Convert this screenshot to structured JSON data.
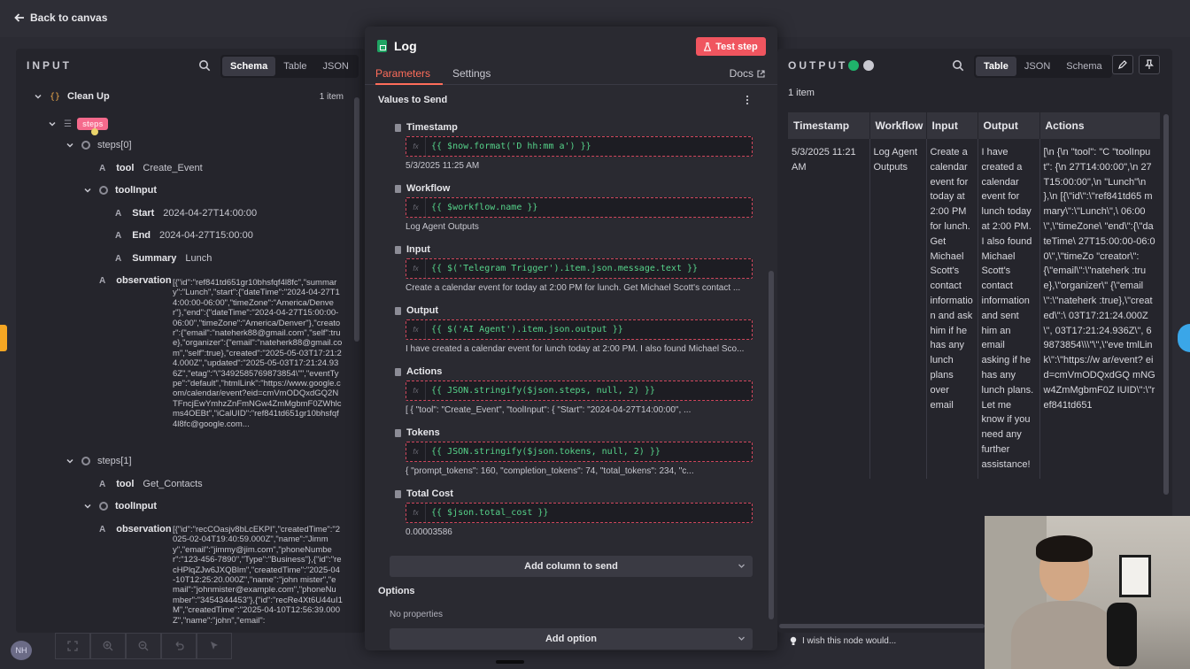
{
  "topbar": {
    "back_label": "Back to canvas"
  },
  "input": {
    "title": "INPUT",
    "views": [
      "Schema",
      "Table",
      "JSON"
    ],
    "active_view": "Schema",
    "root": {
      "name": "Clean Up",
      "count": "1 item"
    },
    "steps_key": "steps",
    "step0": {
      "name": "steps[0]",
      "tool_key": "tool",
      "tool_val": "Create_Event",
      "toolinput_key": "toolInput",
      "start_key": "Start",
      "start_val": "2024-04-27T14:00:00",
      "end_key": "End",
      "end_val": "2024-04-27T15:00:00",
      "summary_key": "Summary",
      "summary_val": "Lunch",
      "observation_key": "observation",
      "observation_val": "[{\"id\":\"ref841td651gr10bhsfqf4l8fc\",\"summary\":\"Lunch\",\"start\":{\"dateTime\":\"2024-04-27T14:00:00-06:00\",\"timeZone\":\"America/Denver\"},\"end\":{\"dateTime\":\"2024-04-27T15:00:00-06:00\",\"timeZone\":\"America/Denver\"},\"creator\":{\"email\":\"nateherk88@gmail.com\",\"self\":true},\"organizer\":{\"email\":\"nateherk88@gmail.com\",\"self\":true},\"created\":\"2025-05-03T17:21:24.000Z\",\"updated\":\"2025-05-03T17:21:24.936Z\",\"etag\":\"\\\"3492585769873854\\\"\",\"eventType\":\"default\",\"htmlLink\":\"https://www.google.com/calendar/event?eid=cmVmODQxdGQ2NTFncjEwYmhzZnFmNGw4ZmMgbmF0ZWhlcms4OEBt\",\"iCalUID\":\"ref841td651gr10bhsfqf4l8fc@google.com..."
    },
    "step1": {
      "name": "steps[1]",
      "tool_key": "tool",
      "tool_val": "Get_Contacts",
      "toolinput_key": "toolInput",
      "observation_key": "observation",
      "observation_val": "[{\"id\":\"recCOasjv8bLcEKPI\",\"createdTime\":\"2025-02-04T19:40:59.000Z\",\"name\":\"Jimmy\",\"email\":\"jimmy@jim.com\",\"phoneNumber\":\"123-456-7890\",\"Type\":\"Business\"},{\"id\":\"recHPlqZJw6JXQBlm\",\"createdTime\":\"2025-04-10T12:25:20.000Z\",\"name\":\"john mister\",\"email\":\"johnmister@example.com\",\"phoneNumber\":\"3454344453\"},{\"id\":\"recRe4Xt6U44uI1M\",\"createdTime\":\"2025-04-10T12:56:39.000Z\",\"name\":\"john\",\"email\":"
    }
  },
  "log": {
    "title": "Log",
    "test_step_label": "Test step",
    "tabs": [
      "Parameters",
      "Settings"
    ],
    "active_tab": "Parameters",
    "docs_label": "Docs",
    "values_title": "Values to Send",
    "fields": [
      {
        "label": "Timestamp",
        "expr": "{{ $now.format('D hh:mm a') }}",
        "preview": "5/3/2025 11:25 AM"
      },
      {
        "label": "Workflow",
        "expr": "{{ $workflow.name }}",
        "preview": "Log Agent Outputs"
      },
      {
        "label": "Input",
        "expr": "{{ $('Telegram Trigger').item.json.message.text }}",
        "preview": "Create a calendar event for today at 2:00 PM for lunch. Get Michael Scott's contact ..."
      },
      {
        "label": "Output",
        "expr": "{{ $('AI Agent').item.json.output }}",
        "preview": "I have created a calendar event for lunch today at 2:00 PM. I also found Michael Sco..."
      },
      {
        "label": "Actions",
        "expr": "{{ JSON.stringify($json.steps, null, 2) }}",
        "preview": "[   {     \"tool\": \"Create_Event\",     \"toolInput\": {       \"Start\": \"2024-04-27T14:00:00\",    ..."
      },
      {
        "label": "Tokens",
        "expr": "{{ JSON.stringify($json.tokens, null, 2) }}",
        "preview": "{   \"prompt_tokens\": 160,   \"completion_tokens\": 74,   \"total_tokens\": 234,   \"c..."
      },
      {
        "label": "Total Cost",
        "expr": "{{ $json.total_cost }}",
        "preview": "0.00003586"
      }
    ],
    "add_column_label": "Add column to send",
    "options_title": "Options",
    "no_properties": "No properties",
    "add_option_label": "Add option"
  },
  "output": {
    "title": "OUTPUT",
    "views": [
      "Table",
      "JSON",
      "Schema"
    ],
    "active_view": "Table",
    "count": "1 item",
    "columns": [
      "Timestamp",
      "Workflow",
      "Input",
      "Output",
      "Actions"
    ],
    "row": [
      "5/3/2025 11:21 AM",
      "Log Agent Outputs",
      "Create a calendar event for today at 2:00 PM for lunch. Get Michael Scott's contact information and ask him if he has any lunch plans over email",
      "I have created a calendar event for lunch today at 2:00 PM. I also found Michael Scott's contact information and sent him an email asking if he has any lunch plans. Let me know if you need any further assistance!",
      "[\\n {\\n \"tool\": \"C \"toolInput\": {\\n 27T14:00:00\",\\n 27T15:00:00\",\\n \"Lunch\"\\n },\\n [{\\\"id\\\":\\\"ref841td65 mmary\\\":\\\"Lunch\\\",\\ 06:00\\\",\\\"timeZone\\ \"end\\\":{\\\"dateTime\\ 27T15:00:00-06:00\\\",\\\"timeZo \"creator\\\": {\\\"email\\\":\\\"nateherk :true},\\\"organizer\\\" {\\\"email\\\":\\\"nateherk :true},\\\"created\\\":\\ 03T17:21:24.000Z\\\", 03T17:21:24.936Z\\\", 69873854\\\\\\\"\\\",\\\"eve tmlLink\\\":\\\"https://w ar/event? eid=cmVmODQxdGQ mNGw4ZmMgbmF0Z IUID\\\":\\\"ref841td651"
    ],
    "hint": "I wish this node would..."
  },
  "user": {
    "initials": "NH"
  }
}
